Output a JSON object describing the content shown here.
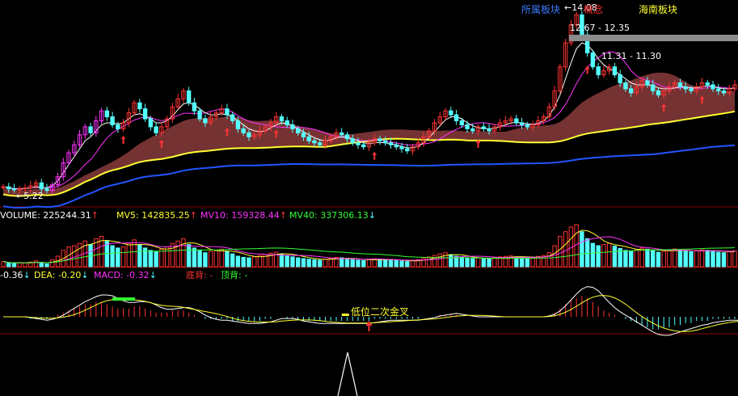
{
  "colors": {
    "background": "#000000",
    "up": "#ff3333",
    "down": "#54ffff",
    "magenta": "#ff33ff",
    "yellow": "#ffff33",
    "green": "#33ff33",
    "white": "#ffffff",
    "blue": "#2255ff",
    "band": "#8a3b3b",
    "grey": "#8c8c8c",
    "divider": "#8b0000"
  },
  "main_panel": {
    "price_labels": {
      "low": "←5.22",
      "high": "←14.08",
      "range_a": "12.67 - 12.35",
      "range_b": "11.31 - 11.30"
    },
    "block_labels": {
      "left": "所属板块",
      "middle": "概念",
      "right": "海南板块"
    }
  },
  "volume_panel": {
    "items": [
      {
        "label": "VOLUME: ",
        "value": "225244.31",
        "arrow": "↑"
      },
      {
        "label": "MV5: ",
        "value": "142835.25",
        "arrow": "↑"
      },
      {
        "label": "MV10: ",
        "value": "159328.44",
        "arrow": "↑"
      },
      {
        "label": "MV40: ",
        "value": "337306.13",
        "arrow": "↓"
      }
    ]
  },
  "macd_panel": {
    "items": [
      {
        "label": "-0.36",
        "arrow": "↓"
      },
      {
        "label": "DEA: -0.20",
        "arrow": "↓"
      },
      {
        "label": "MACD: -0.32",
        "arrow": "↓"
      },
      {
        "label": "底背: -"
      },
      {
        "label": "顶背: -"
      }
    ],
    "annotation": "低位二次金叉"
  },
  "chart_data": [
    {
      "type": "candlestick",
      "title": "",
      "xlabel": "",
      "ylabel": "",
      "ylim": [
        4.8,
        14.5
      ],
      "grid": false,
      "annotations": [
        "←5.22",
        "←14.08",
        "12.67 - 12.35",
        "11.31 - 11.30",
        "所属板块",
        "概念",
        "海南板块"
      ],
      "series": [
        {
          "name": "price",
          "values": [
            5.4,
            5.3,
            5.25,
            5.3,
            5.35,
            5.45,
            5.6,
            5.3,
            5.22,
            5.5,
            5.9,
            6.6,
            7.1,
            7.5,
            8.0,
            8.4,
            8.1,
            8.7,
            9.2,
            8.9,
            8.5,
            8.3,
            8.6,
            9.1,
            9.6,
            9.3,
            8.8,
            8.4,
            8.1,
            8.4,
            8.8,
            9.4,
            9.8,
            10.2,
            9.6,
            9.2,
            8.8,
            8.6,
            8.9,
            9.1,
            9.3,
            9.0,
            8.7,
            8.3,
            8.1,
            7.9,
            8.0,
            8.2,
            8.4,
            8.6,
            8.9,
            8.7,
            8.5,
            8.3,
            8.1,
            7.9,
            7.7,
            7.6,
            7.5,
            7.7,
            7.9,
            8.1,
            8.0,
            7.8,
            7.6,
            7.5,
            7.4,
            7.6,
            7.8,
            7.7,
            7.6,
            7.5,
            7.4,
            7.3,
            7.2,
            7.4,
            7.6,
            7.9,
            8.2,
            8.6,
            8.9,
            9.2,
            9.0,
            8.7,
            8.5,
            8.3,
            8.2,
            8.4,
            8.3,
            8.2,
            8.4,
            8.6,
            8.7,
            8.8,
            8.6,
            8.5,
            8.4,
            8.5,
            8.7,
            8.9,
            9.4,
            10.2,
            11.4,
            12.6,
            13.5,
            14.0,
            13.0,
            12.1,
            11.4,
            11.0,
            11.2,
            11.4,
            11.0,
            10.6,
            10.3,
            10.1,
            10.4,
            10.7,
            10.5,
            10.2,
            10.0,
            10.2,
            10.4,
            10.6,
            10.4,
            10.3,
            10.2,
            10.4,
            10.6,
            10.5,
            10.3,
            10.2,
            10.1,
            10.3,
            10.5
          ]
        },
        {
          "name": "ma_white",
          "values": [
            5.4,
            5.35,
            5.3,
            5.3,
            5.3,
            5.35,
            5.4,
            5.38,
            5.35,
            5.45,
            5.7,
            6.1,
            6.5,
            6.9,
            7.3,
            7.7,
            7.9,
            8.2,
            8.5,
            8.6,
            8.6,
            8.55,
            8.6,
            8.8,
            9.0,
            9.05,
            8.95,
            8.8,
            8.6,
            8.6,
            8.7,
            8.95,
            9.25,
            9.55,
            9.6,
            9.5,
            9.3,
            9.1,
            9.0,
            9.0,
            9.05,
            9.0,
            8.9,
            8.7,
            8.5,
            8.3,
            8.2,
            8.15,
            8.2,
            8.35,
            8.5,
            8.6,
            8.55,
            8.45,
            8.3,
            8.15,
            8.0,
            7.85,
            7.75,
            7.7,
            7.75,
            7.85,
            7.9,
            7.9,
            7.8,
            7.7,
            7.6,
            7.55,
            7.6,
            7.62,
            7.6,
            7.55,
            7.5,
            7.42,
            7.35,
            7.35,
            7.42,
            7.6,
            7.85,
            8.15,
            8.45,
            8.75,
            8.9,
            8.9,
            8.8,
            8.6,
            8.45,
            8.35,
            8.32,
            8.3,
            8.32,
            8.4,
            8.5,
            8.6,
            8.62,
            8.6,
            8.55,
            8.52,
            8.58,
            8.7,
            8.95,
            9.4,
            10.0,
            10.8,
            11.6,
            12.3,
            12.6,
            12.5,
            12.2,
            11.8,
            11.5,
            11.3,
            11.2,
            11.0,
            10.8,
            10.6,
            10.5,
            10.5,
            10.5,
            10.45,
            10.35,
            10.3,
            10.3,
            10.35,
            10.4,
            10.4,
            10.35,
            10.35,
            10.4,
            10.45,
            10.42,
            10.35,
            10.3,
            10.3,
            10.35
          ]
        }
      ]
    },
    {
      "type": "bar",
      "title": "",
      "xlabel": "",
      "ylabel": "",
      "grid": false,
      "series": [
        {
          "name": "VOLUME",
          "values": [
            22,
            15,
            14,
            18,
            16,
            20,
            25,
            14,
            12,
            30,
            45,
            70,
            85,
            90,
            100,
            110,
            95,
            120,
            130,
            110,
            90,
            80,
            85,
            100,
            115,
            95,
            80,
            70,
            65,
            75,
            85,
            100,
            110,
            120,
            95,
            80,
            70,
            60,
            65,
            70,
            75,
            65,
            55,
            45,
            40,
            38,
            42,
            48,
            52,
            58,
            62,
            55,
            48,
            42,
            38,
            35,
            32,
            30,
            28,
            32,
            36,
            40,
            38,
            34,
            30,
            28,
            26,
            30,
            34,
            32,
            30,
            28,
            26,
            24,
            22,
            26,
            30,
            36,
            42,
            48,
            55,
            60,
            52,
            45,
            40,
            36,
            34,
            38,
            36,
            34,
            38,
            42,
            44,
            46,
            42,
            40,
            38,
            40,
            44,
            48,
            60,
            90,
            130,
            150,
            170,
            180,
            150,
            120,
            100,
            90,
            95,
            100,
            88,
            78,
            70,
            65,
            72,
            80,
            75,
            68,
            62,
            66,
            72,
            76,
            70,
            66,
            64,
            68,
            72,
            70,
            66,
            62,
            60,
            64,
            68
          ]
        },
        {
          "name": "MV5",
          "values": []
        },
        {
          "name": "MV10",
          "values": []
        },
        {
          "name": "MV40",
          "values": []
        }
      ]
    },
    {
      "type": "bar",
      "title": "",
      "xlabel": "",
      "ylabel": "",
      "grid": false,
      "series": [
        {
          "name": "MACD",
          "values": [
            0,
            0,
            0,
            0,
            0,
            -1,
            -1,
            -1,
            -1,
            0,
            1,
            2,
            3,
            4,
            5,
            6,
            6,
            7,
            7,
            6,
            5,
            4,
            4,
            4,
            5,
            5,
            4,
            3,
            2,
            2,
            2,
            3,
            3,
            3,
            2,
            1,
            0,
            -1,
            -1,
            -1,
            -1,
            -1,
            -2,
            -2,
            -2,
            -2,
            -2,
            -2,
            -1,
            -1,
            0,
            0,
            -1,
            -1,
            -1,
            -2,
            -2,
            -2,
            -2,
            -2,
            -2,
            -2,
            -2,
            -2,
            -2,
            -2,
            -2,
            -2,
            -1,
            -1,
            -1,
            -1,
            -1,
            -1,
            -1,
            -1,
            -1,
            0,
            0,
            0,
            1,
            1,
            1,
            1,
            0,
            0,
            0,
            0,
            0,
            0,
            0,
            0,
            0,
            0,
            0,
            0,
            0,
            0,
            0,
            0,
            1,
            2,
            4,
            6,
            8,
            9,
            10,
            9,
            7,
            5,
            3,
            2,
            1,
            0,
            -1,
            -2,
            -3,
            -4,
            -5,
            -6,
            -6,
            -5,
            -5,
            -4,
            -4,
            -3,
            -3,
            -2,
            -2,
            -2,
            -1,
            -1,
            -1,
            -1,
            -1,
            -1,
            -1,
            -1,
            -1
          ]
        }
      ]
    }
  ]
}
